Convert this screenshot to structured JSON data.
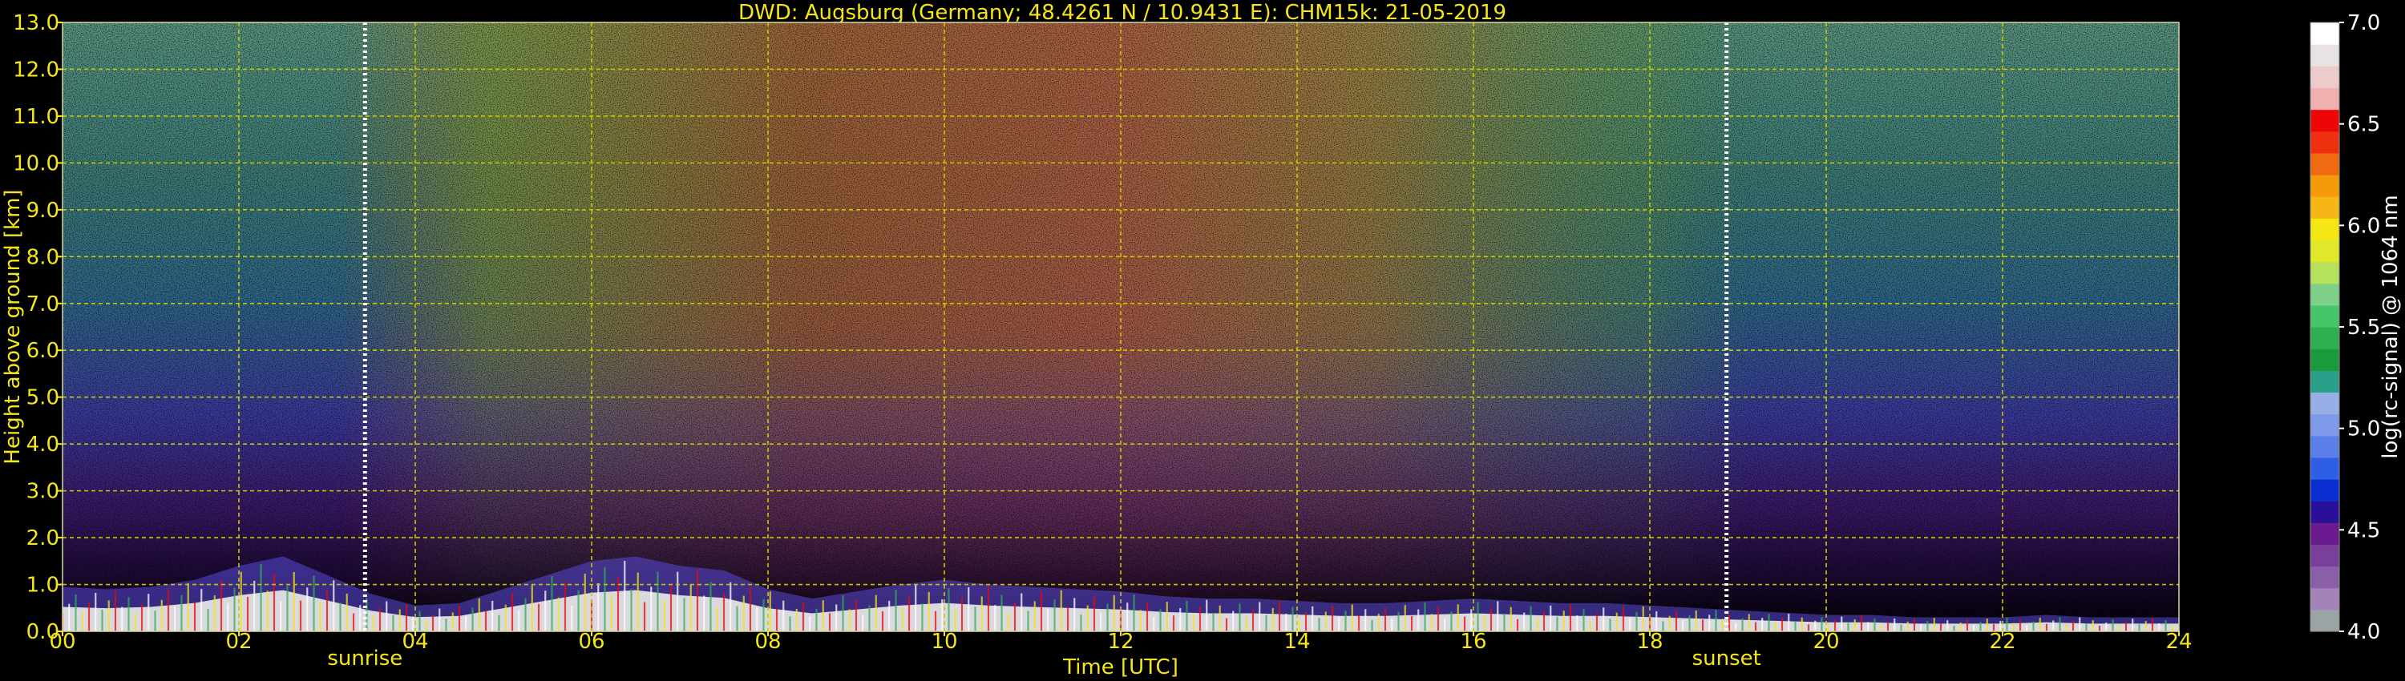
{
  "chart_data": {
    "type": "heatmap",
    "title": "DWD: Augsburg (Germany; 48.4261 N / 10.9431 E):    CHM15k: 21-05-2019",
    "xlabel": "Time [UTC]",
    "ylabel": "Height above ground [km]",
    "xlim": [
      0,
      24
    ],
    "ylim": [
      0,
      13
    ],
    "x_tick_labels": [
      "00",
      "02",
      "04",
      "06",
      "08",
      "10",
      "12",
      "14",
      "16",
      "18",
      "20",
      "22",
      "24"
    ],
    "y_tick_labels": [
      "0.0",
      "1.0",
      "2.0",
      "3.0",
      "4.0",
      "5.0",
      "6.0",
      "7.0",
      "8.0",
      "9.0",
      "10.0",
      "11.0",
      "12.0",
      "13.0"
    ],
    "grid": true,
    "annotations": [
      {
        "label": "sunrise",
        "x": 3.43
      },
      {
        "label": "sunset",
        "x": 18.87
      }
    ],
    "colorbar": {
      "label": "log(rc-signal) @ 1064 nm",
      "min": 4.0,
      "max": 7.0,
      "tick_labels": [
        "4.0",
        "4.5",
        "5.0",
        "5.5",
        "6.0",
        "6.5",
        "7.0"
      ],
      "colors": [
        "#9aa3a5",
        "#a284b8",
        "#8b5fa8",
        "#7a3f9a",
        "#6a1b8f",
        "#2a1098",
        "#0b2fd0",
        "#2f5ee6",
        "#5a7fe8",
        "#7f9ae8",
        "#98aee6",
        "#2aa08a",
        "#1a9a3a",
        "#2fb050",
        "#45c66a",
        "#7fd088",
        "#b6e15a",
        "#dfe82a",
        "#f5e616",
        "#f5b616",
        "#f59a0a",
        "#ef6a10",
        "#ee3010",
        "#ee0606",
        "#f0b0b0",
        "#efcaca",
        "#e8e2e2",
        "#ffffff"
      ]
    },
    "cloud_top_profile_km": [
      [
        0,
        0.95
      ],
      [
        0.5,
        0.9
      ],
      [
        1,
        0.95
      ],
      [
        1.5,
        1.1
      ],
      [
        2,
        1.4
      ],
      [
        2.5,
        1.6
      ],
      [
        3,
        1.2
      ],
      [
        3.5,
        0.8
      ],
      [
        4,
        0.55
      ],
      [
        4.5,
        0.6
      ],
      [
        5,
        0.9
      ],
      [
        5.5,
        1.2
      ],
      [
        6,
        1.5
      ],
      [
        6.5,
        1.6
      ],
      [
        7,
        1.4
      ],
      [
        7.5,
        1.3
      ],
      [
        8,
        0.9
      ],
      [
        8.5,
        0.7
      ],
      [
        9,
        0.85
      ],
      [
        9.5,
        1.0
      ],
      [
        10,
        1.1
      ],
      [
        10.5,
        1.0
      ],
      [
        11,
        0.95
      ],
      [
        11.5,
        0.9
      ],
      [
        12,
        0.85
      ],
      [
        12.5,
        0.75
      ],
      [
        13,
        0.7
      ],
      [
        13.5,
        0.7
      ],
      [
        14,
        0.65
      ],
      [
        14.5,
        0.6
      ],
      [
        15,
        0.6
      ],
      [
        15.5,
        0.65
      ],
      [
        16,
        0.7
      ],
      [
        16.5,
        0.65
      ],
      [
        17,
        0.6
      ],
      [
        17.5,
        0.6
      ],
      [
        18,
        0.55
      ],
      [
        18.5,
        0.5
      ],
      [
        19,
        0.45
      ],
      [
        19.5,
        0.4
      ],
      [
        20,
        0.35
      ],
      [
        20.5,
        0.35
      ],
      [
        21,
        0.3
      ],
      [
        21.5,
        0.3
      ],
      [
        22,
        0.3
      ],
      [
        22.5,
        0.35
      ],
      [
        23,
        0.3
      ],
      [
        23.5,
        0.3
      ],
      [
        24,
        0.3
      ]
    ],
    "colors": {
      "title_text": "#f5e616",
      "axis_text": "#f5e616",
      "grid": "#c8c800",
      "sun_marker": "#ffffff",
      "colorbar_text": "#ffffff"
    }
  }
}
